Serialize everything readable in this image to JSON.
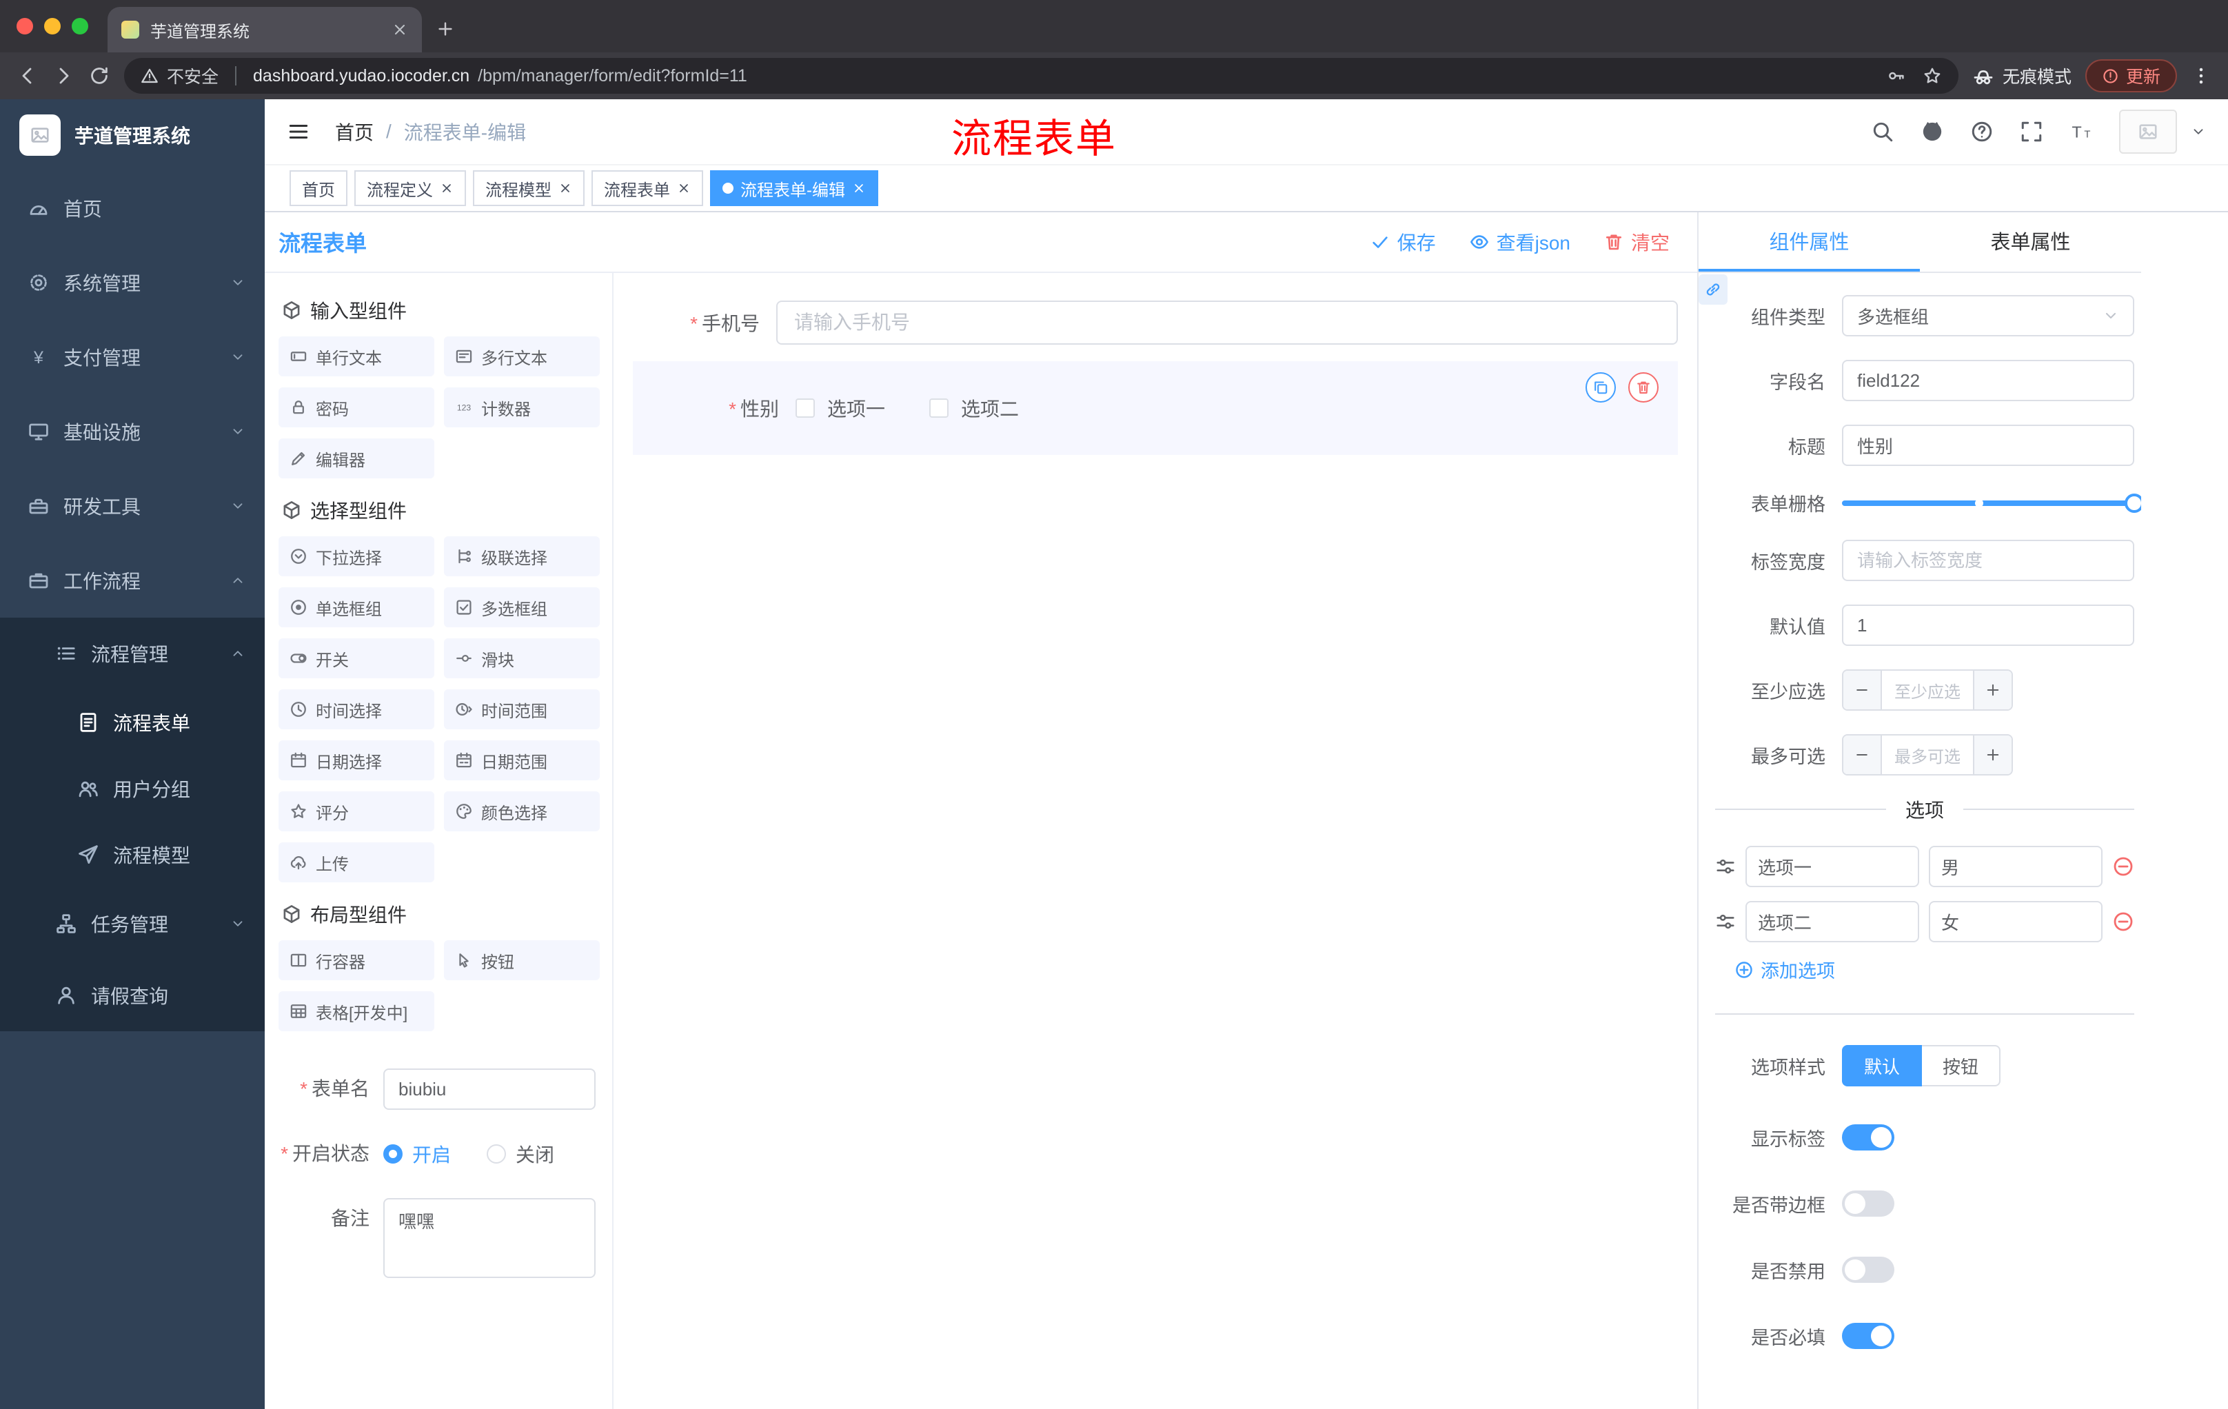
{
  "theme": {
    "primary": "#409eff",
    "danger": "#f56c6c",
    "sidebar_bg": "#304156",
    "annotation_red": "#fe0000",
    "tag_active": "#409eff"
  },
  "browser": {
    "tab_title": "芋道管理系统",
    "security_label": "不安全",
    "url_host": "dashboard.yudao.iocoder.cn",
    "url_path": "/bpm/manager/form/edit?formId=11",
    "incognito_label": "无痕模式",
    "update_label": "更新"
  },
  "sidebar": {
    "logo_title": "芋道管理系统",
    "items": [
      {
        "label": "首页",
        "icon": "gauge"
      },
      {
        "label": "系统管理",
        "icon": "gear"
      },
      {
        "label": "支付管理",
        "icon": "yen"
      },
      {
        "label": "基础设施",
        "icon": "monitor"
      },
      {
        "label": "研发工具",
        "icon": "toolbox"
      },
      {
        "label": "工作流程",
        "icon": "briefcase"
      },
      {
        "label": "流程管理",
        "icon": "list"
      },
      {
        "label": "流程表单",
        "icon": "document"
      },
      {
        "label": "用户分组",
        "icon": "users"
      },
      {
        "label": "流程模型",
        "icon": "send"
      },
      {
        "label": "任务管理",
        "icon": "tree"
      },
      {
        "label": "请假查询",
        "icon": "user"
      }
    ]
  },
  "header": {
    "breadcrumb_home": "首页",
    "breadcrumb_sep": "/",
    "breadcrumb_current": "流程表单-编辑",
    "annotation": "流程表单"
  },
  "tags": [
    {
      "label": "首页"
    },
    {
      "label": "流程定义"
    },
    {
      "label": "流程模型"
    },
    {
      "label": "流程表单"
    },
    {
      "label": "流程表单-编辑"
    }
  ],
  "page": {
    "title": "流程表单",
    "save_label": "保存",
    "view_json_label": "查看json",
    "clear_label": "清空"
  },
  "palette": {
    "sections": [
      {
        "title": "输入型组件",
        "items": [
          {
            "label": "单行文本",
            "icon": "text-field"
          },
          {
            "label": "多行文本",
            "icon": "textarea"
          },
          {
            "label": "密码",
            "icon": "lock"
          },
          {
            "label": "计数器",
            "icon": "counter"
          },
          {
            "label": "编辑器",
            "icon": "editor"
          }
        ]
      },
      {
        "title": "选择型组件",
        "items": [
          {
            "label": "下拉选择",
            "icon": "select"
          },
          {
            "label": "级联选择",
            "icon": "cascader"
          },
          {
            "label": "单选框组",
            "icon": "radio"
          },
          {
            "label": "多选框组",
            "icon": "checkbox"
          },
          {
            "label": "开关",
            "icon": "switch"
          },
          {
            "label": "滑块",
            "icon": "slider-icon"
          },
          {
            "label": "时间选择",
            "icon": "time"
          },
          {
            "label": "时间范围",
            "icon": "time-range"
          },
          {
            "label": "日期选择",
            "icon": "date"
          },
          {
            "label": "日期范围",
            "icon": "date-range"
          },
          {
            "label": "评分",
            "icon": "star"
          },
          {
            "label": "颜色选择",
            "icon": "color"
          },
          {
            "label": "上传",
            "icon": "upload"
          }
        ]
      },
      {
        "title": "布局型组件",
        "items": [
          {
            "label": "行容器",
            "icon": "row"
          },
          {
            "label": "按钮",
            "icon": "button-icon"
          },
          {
            "label": "表格[开发中]",
            "icon": "table"
          }
        ]
      }
    ]
  },
  "form_meta": {
    "name_label": "表单名",
    "name_value": "biubiu",
    "status_label": "开启状态",
    "status_on": "开启",
    "status_off": "关闭",
    "remark_label": "备注",
    "remark_value": "嘿嘿"
  },
  "canvas": {
    "phone_label": "手机号",
    "phone_placeholder": "请输入手机号",
    "gender_label": "性别",
    "gender_options": [
      "选项一",
      "选项二"
    ]
  },
  "props": {
    "tab_component": "组件属性",
    "tab_form": "表单属性",
    "component_type_label": "组件类型",
    "component_type_value": "多选框组",
    "field_label": "字段名",
    "field_value": "field122",
    "title_label": "标题",
    "title_value": "性别",
    "grid_label": "表单栅格",
    "label_width_label": "标签宽度",
    "label_width_placeholder": "请输入标签宽度",
    "default_label": "默认值",
    "default_value": "1",
    "min_label": "至少应选",
    "min_placeholder": "至少应选",
    "max_label": "最多可选",
    "max_placeholder": "最多可选",
    "options_title": "选项",
    "options": [
      {
        "label": "选项一",
        "value": "男"
      },
      {
        "label": "选项二",
        "value": "女"
      }
    ],
    "add_option": "添加选项",
    "style_label": "选项样式",
    "style_default": "默认",
    "style_button": "按钮",
    "toggle_show_label": "显示标签",
    "toggle_border": "是否带边框",
    "toggle_disabled": "是否禁用",
    "toggle_required": "是否必填"
  }
}
